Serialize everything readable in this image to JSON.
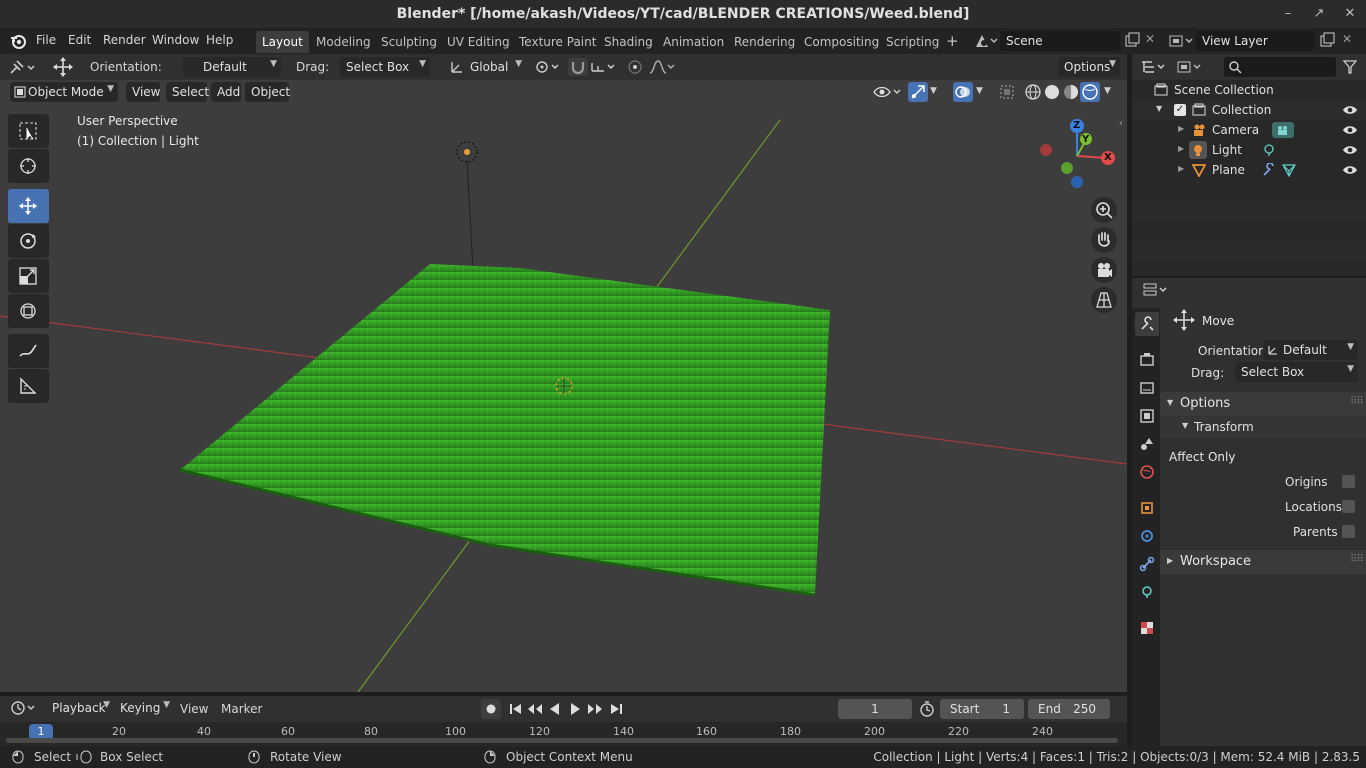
{
  "window": {
    "title": "Blender* [/home/akash/Videos/YT/cad/BLENDER CREATIONS/Weed.blend]",
    "controls": [
      "–",
      "↗",
      "✕"
    ]
  },
  "menu": {
    "items": [
      "File",
      "Edit",
      "Render",
      "Window",
      "Help"
    ]
  },
  "workspaces": {
    "tabs": [
      "Layout",
      "Modeling",
      "Sculpting",
      "UV Editing",
      "Texture Paint",
      "Shading",
      "Animation",
      "Rendering",
      "Compositing",
      "Scripting"
    ],
    "active": "Layout",
    "add": "+"
  },
  "scene": {
    "name": "Scene"
  },
  "view_layer": {
    "name": "View Layer"
  },
  "tool_header": {
    "orientation_label": "Orientation:",
    "orientation_value": "Default",
    "drag_label": "Drag:",
    "drag_value": "Select Box",
    "transform_orientation": "Global",
    "options": "Options"
  },
  "viewport_header": {
    "mode": "Object Mode",
    "menus": [
      "View",
      "Select",
      "Add",
      "Object"
    ]
  },
  "viewport": {
    "perspective": "User Perspective",
    "context": "(1) Collection | Light",
    "gizmo": {
      "x": "X",
      "y": "Y",
      "z": "Z"
    }
  },
  "outliner": {
    "search_placeholder": "",
    "root": "Scene Collection",
    "collection": "Collection",
    "items": [
      "Camera",
      "Light",
      "Plane"
    ]
  },
  "properties": {
    "tool_name": "Move",
    "orientation_label": "Orientation",
    "orientation_value": "Default",
    "drag_label": "Drag:",
    "drag_value": "Select Box",
    "options_panel": "Options",
    "transform_panel": "Transform",
    "affect_only": "Affect Only",
    "checks": [
      {
        "label": "Origins",
        "checked": false
      },
      {
        "label": "Locations",
        "checked": false
      },
      {
        "label": "Parents",
        "checked": false
      }
    ],
    "workspace_panel": "Workspace"
  },
  "timeline": {
    "menus": [
      "Playback",
      "Keying",
      "View",
      "Marker"
    ],
    "current_frame": "1",
    "start_label": "Start",
    "start": "1",
    "end_label": "End",
    "end": "250",
    "ruler": [
      "1",
      "20",
      "40",
      "60",
      "80",
      "100",
      "120",
      "140",
      "160",
      "180",
      "200",
      "220",
      "240"
    ]
  },
  "status": {
    "select": "Select",
    "box_select": "Box Select",
    "rotate": "Rotate View",
    "context_menu": "Object Context Menu",
    "info": "Collection | Light | Verts:4 | Faces:1 | Tris:2 | Objects:0/3 | Mem: 52.4 MiB | 2.83.5"
  },
  "colors": {
    "accent": "#4772b3",
    "grass": "#2f9d20",
    "x_axis": "#e04a4a",
    "y_axis": "#7bbf2a",
    "z_axis": "#3a82e0"
  }
}
